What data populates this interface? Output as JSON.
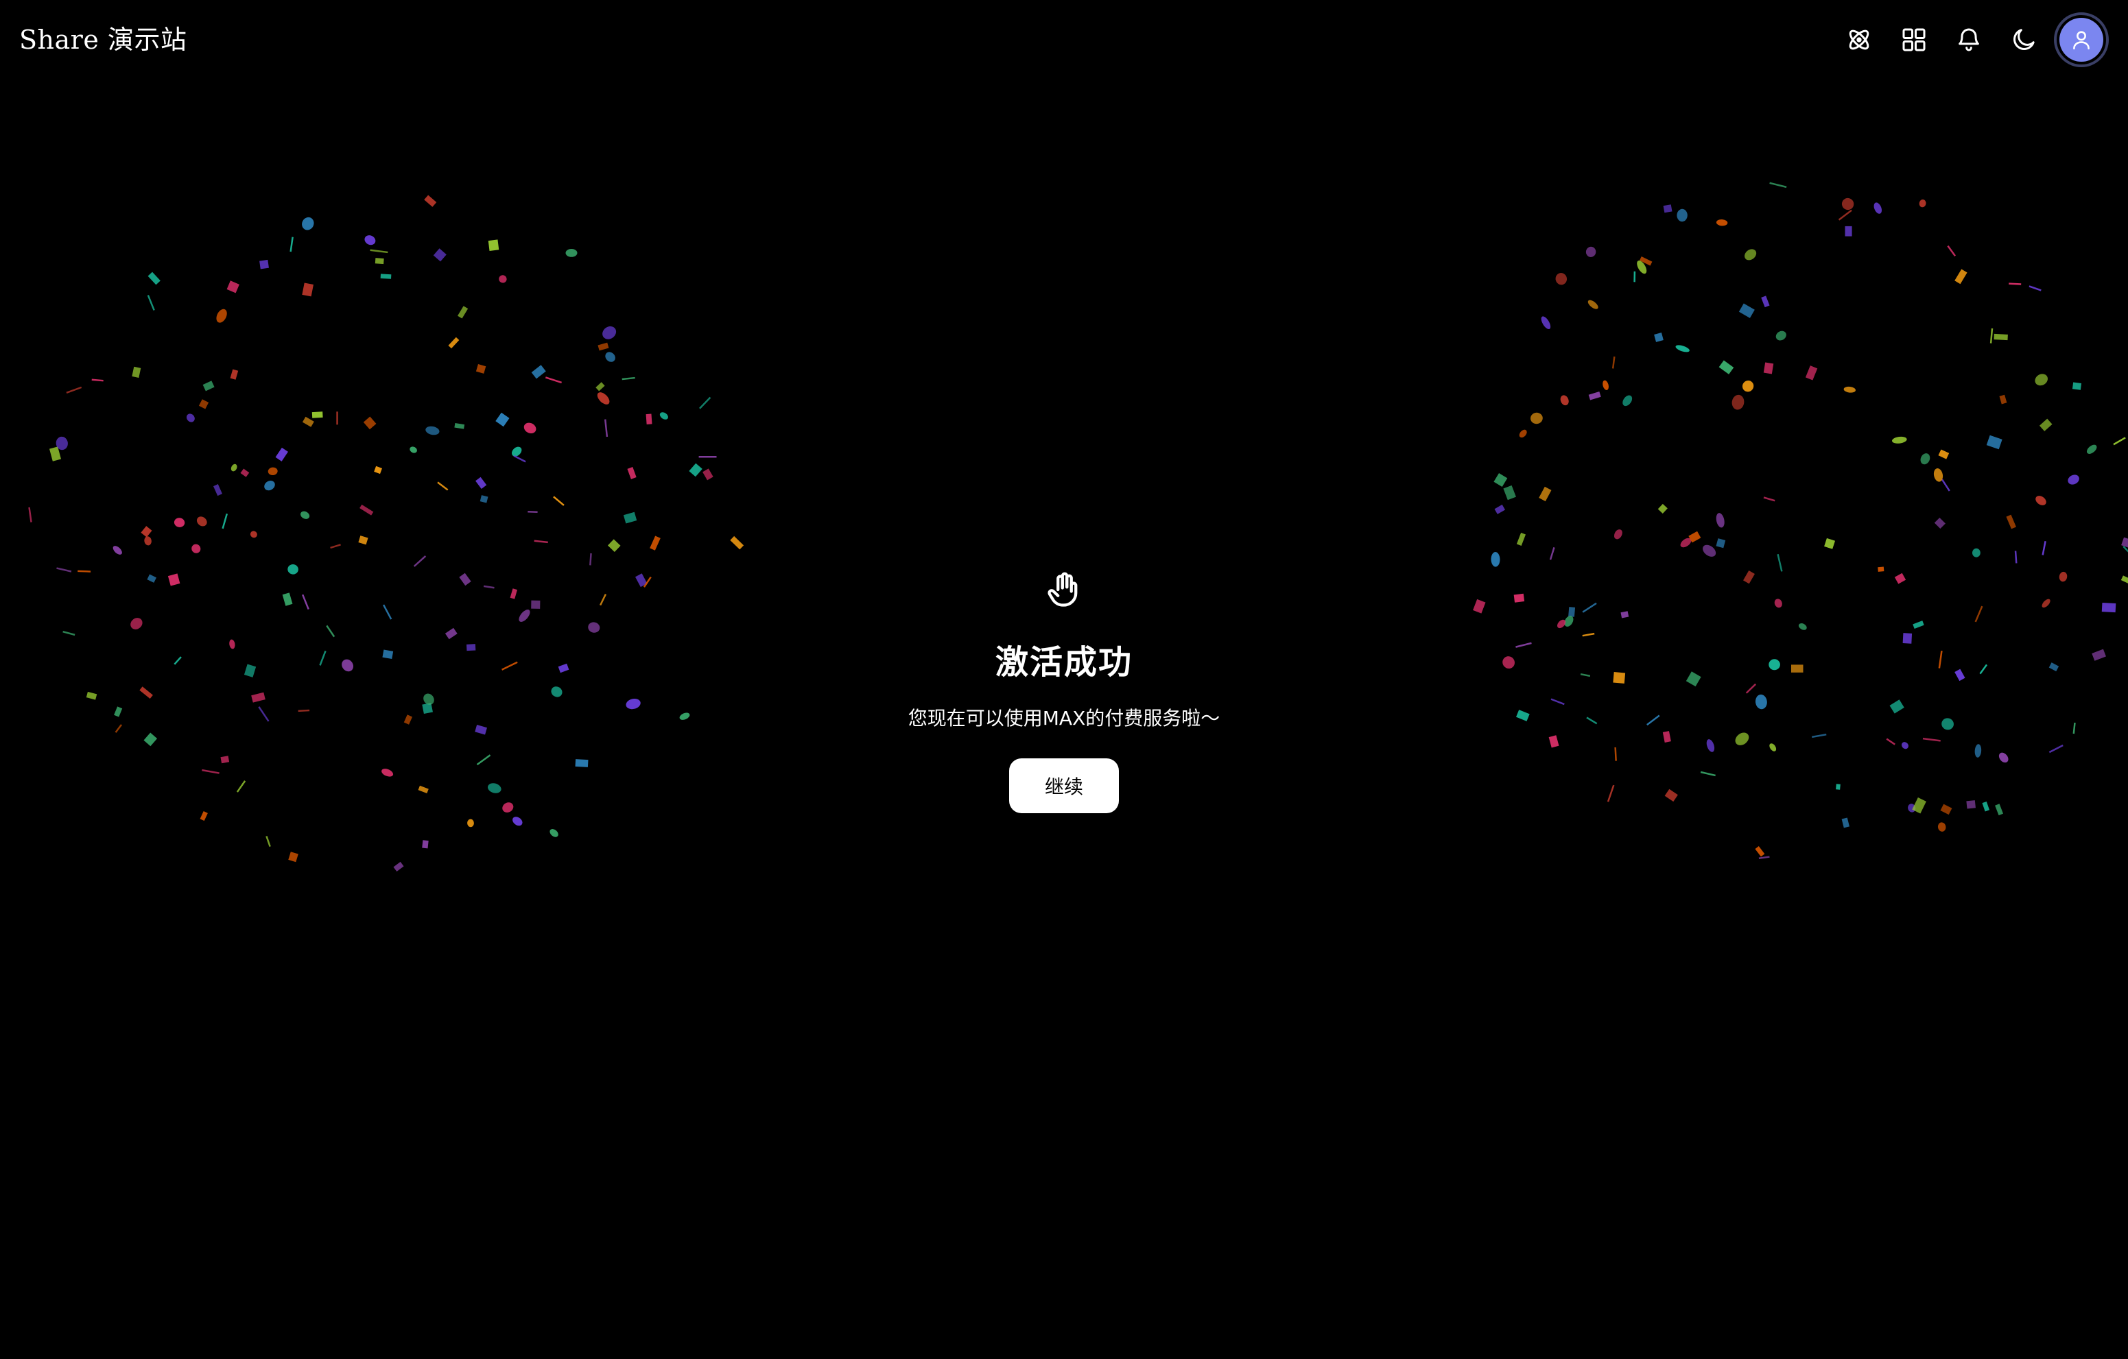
{
  "header": {
    "brand": "Share 演示站",
    "actions": [
      {
        "name": "atom-icon-button",
        "icon": "atom-icon"
      },
      {
        "name": "apps-grid-button",
        "icon": "grid-icon"
      },
      {
        "name": "notifications-button",
        "icon": "bell-icon"
      },
      {
        "name": "theme-toggle-button",
        "icon": "moon-icon"
      }
    ],
    "avatar": {
      "icon": "user-icon",
      "color": "#7b86f0"
    }
  },
  "main": {
    "icon": "hand-icon",
    "title": "激活成功",
    "subtitle": "您现在可以使用MAX的付费服务啦～",
    "continue_label": "继续"
  },
  "colors": {
    "background": "#000000",
    "text": "#ffffff",
    "button_bg": "#ffffff",
    "button_text": "#000000",
    "confetti": [
      "#e1306c",
      "#8e44ad",
      "#6c3fe0",
      "#2e86c1",
      "#3cb371",
      "#9acd32",
      "#f39c12",
      "#d35400",
      "#c0392b",
      "#1abc9c"
    ]
  }
}
